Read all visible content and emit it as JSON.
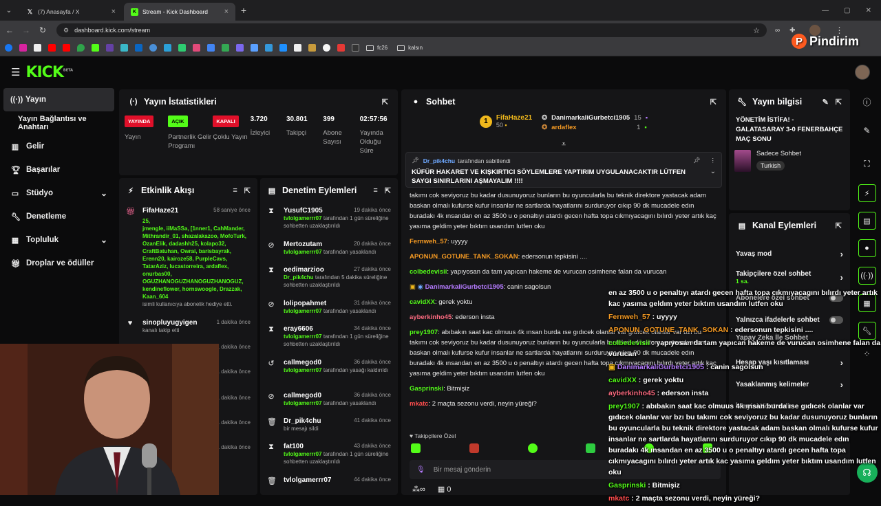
{
  "browser": {
    "tabs": [
      {
        "label": "(7) Anasayfa / X",
        "icon": "x-logo-icon"
      },
      {
        "label": "Stream - Kick Dashboard",
        "icon": "kick-logo-icon"
      }
    ],
    "url": "dashboard.kick.com/stream",
    "bookmark_folders": [
      "fc26",
      "kalsın"
    ]
  },
  "watermark": "Pindirim",
  "sidebar": {
    "items": [
      {
        "label": "Yayın",
        "icon": "broadcast-icon"
      },
      {
        "label": "Yayın Bağlantısı ve Anahtarı",
        "icon": ""
      },
      {
        "label": "Gelir",
        "icon": "chart-icon"
      },
      {
        "label": "Başarılar",
        "icon": "trophy-icon"
      },
      {
        "label": "Stüdyo",
        "icon": "studio-icon"
      },
      {
        "label": "Denetleme",
        "icon": "wrench-icon"
      },
      {
        "label": "Topluluk",
        "icon": "community-icon"
      },
      {
        "label": "Droplar ve ödüller",
        "icon": "gift-icon"
      }
    ]
  },
  "stats": {
    "title": "Yayın İstatistikleri",
    "items": [
      {
        "badge": "YAYINDA",
        "label": "Yayın",
        "color": "#e0102a"
      },
      {
        "badge": "AÇIK",
        "label": "Partnerlik Gelir Programı",
        "color": "#53fc18"
      },
      {
        "badge": "KAPALI",
        "label": "Çoklu Yayın",
        "color": "#e0102a"
      },
      {
        "value": "3.720",
        "label": "İzleyici"
      },
      {
        "value": "30.801",
        "label": "Takipçi"
      },
      {
        "value": "399",
        "label": "Abone Sayısı"
      },
      {
        "value": "02:57:56",
        "label": "Yayında Olduğu Süre"
      }
    ]
  },
  "activity": {
    "title": "Etkinlik Akışı",
    "items": [
      {
        "user": "FifaHaze21",
        "time": "58 saniye önce",
        "count": "25,",
        "names": "jmengle, iiMaSSa, [1nner1, CahMander, Mithrandir_01, shazalakazoo, MofoTurk, OzanElik, dadashh25, kolapo32, CraftBatuhan, Owrai, barisbayrak, Erenn20, kairoze58, PurpleCavs, TatarAziz, lucastorreira, ardaflex, onurbas00, OGUZHANOGUZHANOGUZHANOGUZ, kendineflower, hornswoogle, Drazzak, Kaan_604",
        "desc": "isimli kullanıcıya abonelik hediye etti."
      },
      {
        "user": "sinopluyugyigen",
        "time": "1 dakika önce",
        "desc": "kanalı takip etti"
      }
    ],
    "partial_times": [
      "1 dakika önce",
      "1 dakika önce",
      "1 dakika önce",
      "1 dakika önce",
      "1 dakika önce"
    ]
  },
  "moderation": {
    "title": "Denetim Eylemleri",
    "items": [
      {
        "user": "YusufC1905",
        "time": "19 dakika önce",
        "by": "tvlolgamerrr07",
        "desc": "tarafından 1 gün süreliğine sohbetten uzaklaştırıldı",
        "icon": "hourglass-icon"
      },
      {
        "user": "Mertozutam",
        "time": "20 dakika önce",
        "by": "tvlolgamerrr07",
        "desc": "tarafından yasaklandı",
        "icon": "ban-icon"
      },
      {
        "user": "oedimarzioo",
        "time": "27 dakika önce",
        "by": "Dr_pik4chu",
        "desc": "tarafından 5 dakika süreliğine sohbetten uzaklaştırıldı",
        "icon": "hourglass-icon"
      },
      {
        "user": "lolipopahmet",
        "time": "31 dakika önce",
        "by": "tvlolgamerrr07",
        "desc": "tarafından yasaklandı",
        "icon": "ban-icon"
      },
      {
        "user": "eray6606",
        "time": "34 dakika önce",
        "by": "tvlolgamerrr07",
        "desc": "tarafından 1 gün süreliğine sohbetten uzaklaştırıldı",
        "icon": "hourglass-icon"
      },
      {
        "user": "callmegod0",
        "time": "36 dakika önce",
        "by": "tvlolgamerrr07",
        "desc": "tarafından yasağı kaldırıldı",
        "icon": "undo-icon"
      },
      {
        "user": "callmegod0",
        "time": "36 dakika önce",
        "by": "tvlolgamerrr07",
        "desc": "tarafından yasaklandı",
        "icon": "ban-icon"
      },
      {
        "user": "Dr_pik4chu",
        "time": "41 dakika önce",
        "by": "",
        "desc": "bir mesajı sildi",
        "icon": "trash-icon"
      },
      {
        "user": "fat100",
        "time": "43 dakika önce",
        "by": "tvlolgamerrr07",
        "desc": "tarafından 1 gün süreliğine sohbetten uzaklaştırıldı",
        "icon": "hourglass-icon"
      },
      {
        "user": "tvlolgamerrr07",
        "time": "44 dakika önce",
        "by": "",
        "desc": "",
        "icon": "trash-icon"
      }
    ]
  },
  "chat": {
    "title": "Sohbet",
    "top_gifters": [
      {
        "name": "FifaHaze21",
        "count": "50",
        "rank": "1"
      },
      {
        "name": "DanimarkaliGurbetci1905",
        "count": "15"
      },
      {
        "name": "ardaflex",
        "count": "1"
      }
    ],
    "pinned": {
      "by": "Dr_pik4chu",
      "by_suffix": "tarafından sabitlendi",
      "text": "KÜFÜR HAKARET VE KIŞKIRTICI SÖYLEMLERE YAPTIRIM UYGULANACAKTIR LÜTFEN SAYGI SINIRLARINI AŞMAYALIM !!!!"
    },
    "messages": [
      {
        "user": "",
        "color": "#e9e9e9",
        "text": "takımı cok seviyoruz bu kadar dusunuyoruz bunların bu oyuncularla bu teknik direktore yastacak adam baskan olmalı kufurse kufur insanlar ne sartlarda hayatlarını surduruyor cıkıp 90 dk mucadele edın buradakı 4k ınsandan en az 3500 u o penaltıyı atardı gecen hafta topa cıkmıyacagını bılırdı yeter artık kaç yasıma geldim yeter bıktım usandım lutfen oku"
      },
      {
        "user": "Fernweh_57",
        "color": "#f59a23",
        "text": "uyyyy"
      },
      {
        "user": "APONUN_GOTUNE_TANK_SOKAN",
        "color": "#f59a23",
        "text": "edersonun tepkisini ...."
      },
      {
        "user": "colbedevisii",
        "color": "#53fc18",
        "text": "yapıyosan da tam yapıcan hakeme de vurucan osimhene falan da vurucan"
      },
      {
        "user": "DanimarkaliGurbetci1905",
        "color": "#b57bff",
        "text": "canin sagolsun"
      },
      {
        "user": "cavidXX",
        "color": "#53fc18",
        "text": "gerek yoktu"
      },
      {
        "user": "ayberkinho45",
        "color": "#ff6b81",
        "text": "ederson insta"
      },
      {
        "user": "prey1907",
        "color": "#53fc18",
        "text": "abıbakın saat kac olmuus 4k ınsan burda ıse gıdıcek olanlar var gıdıcek olanlar var bzı bu takımı cok seviyoruz bu kadar dusunuyoruz bunların bu oyuncularla bu teknik direktore yastacak adam baskan olmalı kufurse kufur insanlar ne sartlarda hayatlarını surduruyor cıkıp 90 dk mucadele edın buradakı 4k ınsandan en az 3500 u o penaltıyı atardı gecen hafta topa cıkmıyacagını bılırdı yeter artık kaç yasıma geldim yeter bıktım usandım lutfen oku"
      },
      {
        "user": "Gasprinski",
        "color": "#53fc18",
        "text": "Bitmişiz"
      },
      {
        "user": "mkatc",
        "color": "#ff4d4d",
        "text": "2 maçta sezonu verdi, neyin yüreği?"
      }
    ],
    "followers_label": "Takipçilere Özel",
    "input_placeholder": "Bir mesaj gönderin",
    "footer_count": "0"
  },
  "stream_info": {
    "title": "Yayın bilgisi",
    "stream_title": "YÖNETİM İSTİFA! - GALATASARAY 3-0 FENERBAHÇE MAÇ SONU",
    "category": "Sadece Sohbet",
    "language": "Turkish"
  },
  "channel_actions": {
    "title": "Kanal Eylemleri",
    "items": [
      {
        "label": "Yavaş mod",
        "control": "chevron"
      },
      {
        "label": "Takipçilere özel sohbet",
        "sub": "1 sa.",
        "control": "chevron"
      },
      {
        "label": "Abonelere özel sohbet",
        "control": "toggle"
      },
      {
        "label": "Yalnızca ifadelerle sohbet",
        "control": "toggle"
      },
      {
        "label": "Yapay Zeka İle Sohbet",
        "control": "toggle"
      },
      {
        "label": "Hesap yaşı kısıtlaması",
        "control": "chevron"
      },
      {
        "label": "Yasaklanmış kelimeler",
        "control": "chevron"
      },
      {
        "label": "İzleyici Yöntendir",
        "control": ""
      }
    ]
  },
  "overlay": {
    "lines": [
      {
        "user": "",
        "color": "#ffffff",
        "text": "en az 3500 u o penaltıyı atardı gecen hafta topa cıkmıyacagını bılırdı yeter artık kac yasıma geldım yeter bıktım usandım lutfen oku"
      },
      {
        "user": "Fernweh_57",
        "color": "#f59a23",
        "text": " : uyyyy"
      },
      {
        "user": "APONUN_GOTUNE_TANK_SOKAN",
        "color": "#f59a23",
        "text": " : edersonun tepkisini ...."
      },
      {
        "user": "colbedevisii",
        "color": "#53fc18",
        "text": " : yapıyosan da tam yapıcan hakeme de vurucan osimhene falan da vurucan"
      },
      {
        "user": "DanimarkaliGurbetci1905",
        "color": "#b57bff",
        "text": " : canin sagolsun"
      },
      {
        "user": "cavidXX",
        "color": "#53fc18",
        "text": " : gerek yoktu"
      },
      {
        "user": "ayberkinho45",
        "color": "#ff6b81",
        "text": " : ederson insta"
      },
      {
        "user": "prey1907",
        "color": "#53fc18",
        "text": " : abıbakın saat kac olmuus 4k ınsan burda ıse gıdıcek olanlar var gıdıcek olanlar var bzı bu takımı cok seviyoruz bu kadar dusunuyoruz bunların bu oyuncularla bu teknik direktore yastacak adam baskan olmalı kufurse kufur insanlar ne sartlarda hayatlarını surduruyor cıkıp 90 dk mucadele edın buradakı 4k ınsandan en az 3500 u o penaltıyı atardı gecen hafta topa cıkmıyacagını bılırdı yeter artık kac yasıma geldım yeter bıktım usandım lutfen oku"
      },
      {
        "user": "Gasprinski",
        "color": "#53fc18",
        "text": " : Bitmişiz"
      },
      {
        "user": "mkatc",
        "color": "#ff4d4d",
        "text": " : 2 maçta sezonu verdi, neyin yüreği?"
      }
    ]
  },
  "colors": {
    "accent": "#53fc18",
    "live": "#e0102a",
    "panel": "#151517",
    "bg": "#0b0b0c"
  }
}
